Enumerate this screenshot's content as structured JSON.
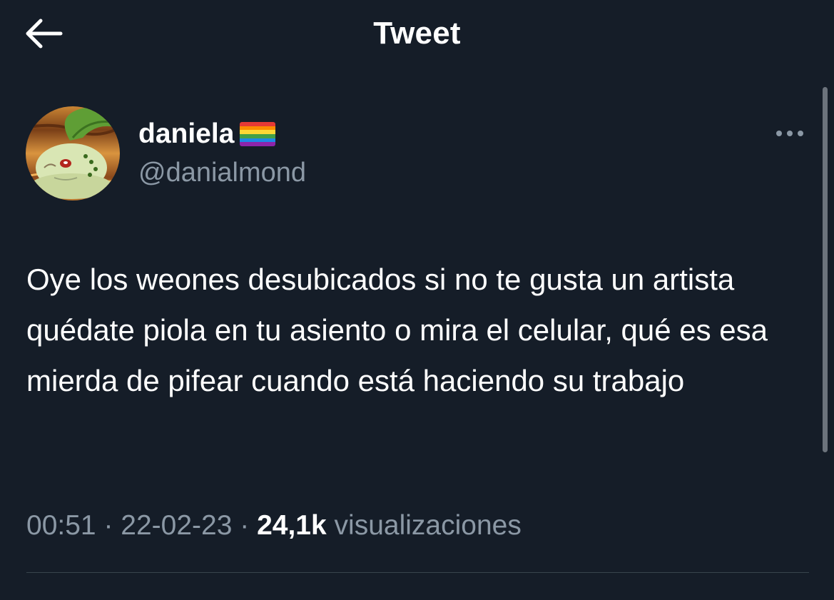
{
  "header": {
    "title": "Tweet",
    "back_icon": "arrow-left-icon"
  },
  "tweet": {
    "author": {
      "display_name": "daniela",
      "name_emoji": "rainbow-flag-icon",
      "handle": "@danialmond",
      "avatar": "chikorita-avatar"
    },
    "more_icon": "more-horizontal-icon",
    "text": "Oye los weones desubicados si no te gusta un artista quédate piola en tu asiento o mira el celular, qué es esa mierda de pifear cuando está haciendo su trabajo",
    "time": "00:51",
    "separator_1": " · ",
    "date": "22-02-23",
    "separator_2": " · ",
    "views_count": "24,1k",
    "views_label": " visualizaciones"
  },
  "colors": {
    "background": "#151d28",
    "primary_text": "#ffffff",
    "secondary_text": "#8b98a5",
    "divider": "#38444d"
  }
}
